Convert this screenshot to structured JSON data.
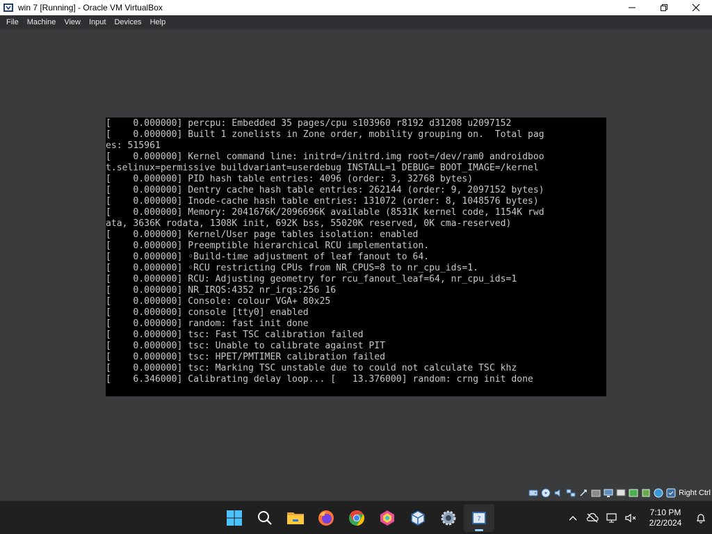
{
  "window": {
    "title": "win 7 [Running] - Oracle VM VirtualBox"
  },
  "menu": {
    "items": [
      "File",
      "Machine",
      "View",
      "Input",
      "Devices",
      "Help"
    ]
  },
  "console": {
    "lines": [
      "[    0.000000] percpu: Embedded 35 pages/cpu s103960 r8192 d31208 u2097152",
      "[    0.000000] Built 1 zonelists in Zone order, mobility grouping on.  Total pag",
      "es: 515961",
      "[    0.000000] Kernel command line: initrd=/initrd.img root=/dev/ram0 androidboo",
      "t.selinux=permissive buildvariant=userdebug INSTALL=1 DEBUG= BOOT_IMAGE=/kernel",
      "[    0.000000] PID hash table entries: 4096 (order: 3, 32768 bytes)",
      "[    0.000000] Dentry cache hash table entries: 262144 (order: 9, 2097152 bytes)",
      "[    0.000000] Inode-cache hash table entries: 131072 (order: 8, 1048576 bytes)",
      "[    0.000000] Memory: 2041676K/2096696K available (8531K kernel code, 1154K rwd",
      "ata, 3636K rodata, 1308K init, 692K bss, 55020K reserved, 0K cma-reserved)",
      "[    0.000000] Kernel/User page tables isolation: enabled",
      "[    0.000000] Preemptible hierarchical RCU implementation.",
      "[    0.000000] ◦Build-time adjustment of leaf fanout to 64.",
      "[    0.000000] ◦RCU restricting CPUs from NR_CPUS=8 to nr_cpu_ids=1.",
      "[    0.000000] RCU: Adjusting geometry for rcu_fanout_leaf=64, nr_cpu_ids=1",
      "[    0.000000] NR_IRQS:4352 nr_irqs:256 16",
      "[    0.000000] Console: colour VGA+ 80x25",
      "[    0.000000] console [tty0] enabled",
      "[    0.000000] random: fast init done",
      "[    0.000000] tsc: Fast TSC calibration failed",
      "[    0.000000] tsc: Unable to calibrate against PIT",
      "[    0.000000] tsc: HPET/PMTIMER calibration failed",
      "[    0.000000] tsc: Marking TSC unstable due to could not calculate TSC khz",
      "[    6.346000] Calibrating delay loop... [   13.376000] random: crng init done"
    ]
  },
  "statusbar": {
    "host_key": "Right Ctrl",
    "icons": [
      "hard-disk-icon",
      "optical-drive-icon",
      "audio-icon",
      "network-icon",
      "usb-icon",
      "shared-folders-icon",
      "display-icon",
      "video-capture-icon",
      "mouse-integration-icon",
      "cpu-icon",
      "keyboard-icon",
      "host-key-icon"
    ]
  },
  "taskbar": {
    "apps": [
      "start-icon",
      "search-icon",
      "file-explorer-icon",
      "firefox-icon",
      "chrome-icon",
      "app-hexagon-icon",
      "virtualbox-icon",
      "settings-icon",
      "win7-vm-icon"
    ],
    "time": "7:10 PM",
    "date": "2/2/2024"
  }
}
